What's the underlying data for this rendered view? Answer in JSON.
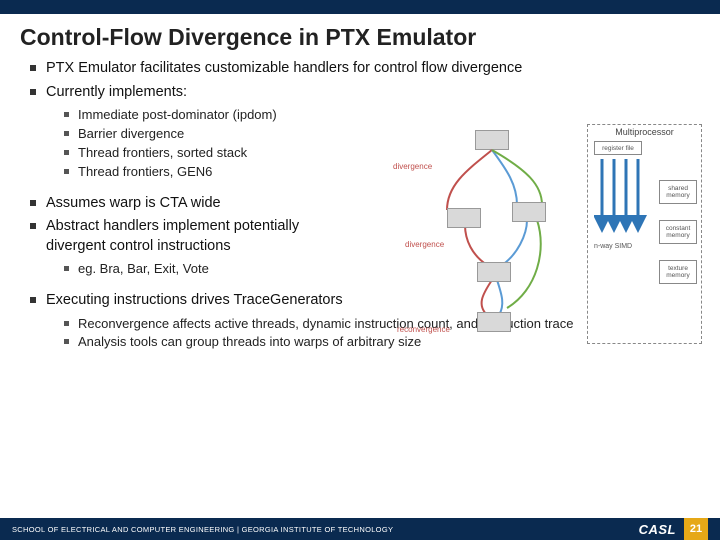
{
  "title": "Control-Flow Divergence in PTX Emulator",
  "bullets": {
    "b1": "PTX Emulator facilitates customizable handlers for control flow divergence",
    "b2": "Currently implements:",
    "b2_sub": {
      "s1": "Immediate post-dominator (ipdom)",
      "s2": "Barrier divergence",
      "s3": "Thread frontiers, sorted stack",
      "s4": "Thread frontiers, GEN6"
    },
    "b3": "Assumes warp is CTA wide",
    "b4": "Abstract handlers implement potentially divergent control instructions",
    "b4_sub": {
      "s1": "eg.  Bra, Bar, Exit, Vote"
    },
    "b5": "Executing instructions drives TraceGenerators",
    "b5_sub": {
      "s1": "Reconvergence affects active threads, dynamic instruction count, and instruction trace",
      "s2": "Analysis tools can group threads into warps of arbitrary size"
    }
  },
  "diagram": {
    "mp_title": "Multiprocessor",
    "labels": {
      "div1": "divergence",
      "div2": "divergence",
      "reconv": "reconvergence",
      "regfile": "register file",
      "shared": "shared memory",
      "const": "constant memory",
      "texture": "texture memory",
      "simd": "n-way SIMD"
    }
  },
  "footer": {
    "text": "SCHOOL OF ELECTRICAL AND COMPUTER ENGINEERING | GEORGIA INSTITUTE OF TECHNOLOGY",
    "logo": "CASL",
    "page": "21"
  }
}
